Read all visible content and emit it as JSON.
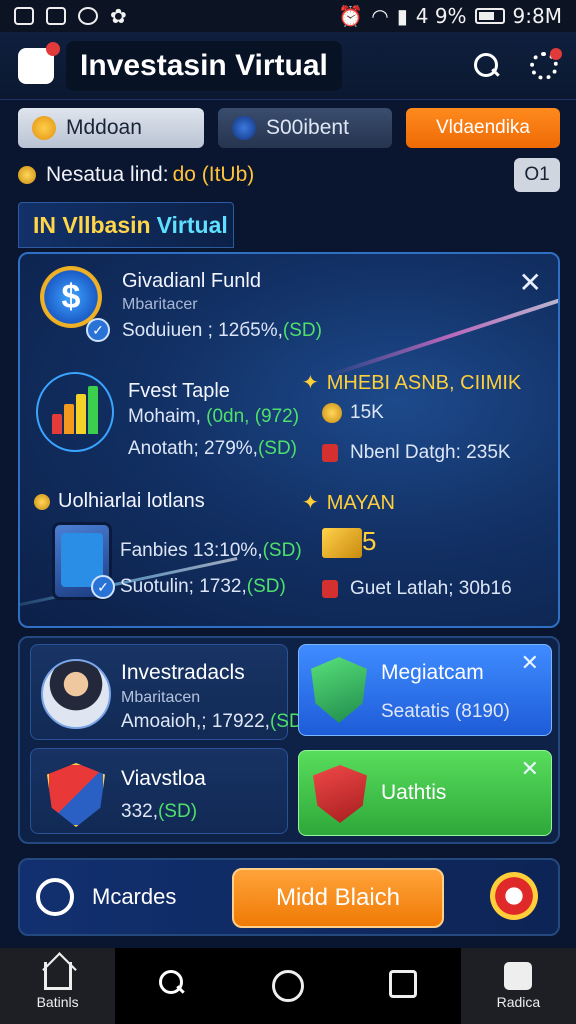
{
  "status_bar": {
    "battery": "4 9%",
    "time": "9:8M"
  },
  "app": {
    "title": "Investasin Virtual"
  },
  "chips": [
    {
      "label": "Mddoan",
      "color": "#c8cfdb"
    },
    {
      "label": "S00ibent",
      "color": "#2c3a58"
    },
    {
      "label": "Vldaendika",
      "color": "#f57a10"
    }
  ],
  "balance": {
    "prefix": "Nesatua lind:",
    "highlight": "do (ItUb)",
    "button": "O1"
  },
  "section": {
    "title_main": "IN Vllbasin",
    "title_accent": "Virtual"
  },
  "panel": {
    "close": "✕",
    "items": [
      {
        "title": "Givadianl Funld",
        "sub": "Mbaritacer",
        "line_prefix": "Soduiuen ; 12б5%,",
        "line_value": "(SD)"
      },
      {
        "title": "Fvest Taple",
        "line1_prefix": "Mohaim,",
        "line1_value": "(0dn, (972)",
        "line2_prefix": "Anotath; 279%,",
        "line2_value": "(SD)"
      },
      {
        "title": "Uolhiarlai lotlans",
        "line1_prefix": "Fanbies 13:10%,",
        "line1_value": "(SD)",
        "line2_prefix": "Suotulin; 1732,",
        "line2_value": "(SD)"
      }
    ],
    "right": {
      "heading1": "MHEBI ASNB, CIIMIK",
      "amount1": "15K",
      "detail1": "Nbenl Datgh: 235K",
      "heading2": "MAYAN",
      "amount2": "5",
      "detail2": "Guet Latlah; 30b16"
    }
  },
  "cards": {
    "investr": {
      "title": "Investradacls",
      "sub": "Mbaritacen",
      "line_prefix": "Amoaioh,; 17922,",
      "line_value": "(SD)"
    },
    "vias": {
      "title": "Viavstloa",
      "line_prefix": "332,",
      "line_value": "(SD)"
    },
    "mega": {
      "title": "Megiatcam",
      "line": "Seatatis (8190)",
      "close": "✕"
    },
    "uath": {
      "title": "Uathtis",
      "close": "✕"
    }
  },
  "action_bar": {
    "label": "Mcardes",
    "cta": "Midd Blaich"
  },
  "bottom_nav": [
    {
      "label": "Batinls",
      "icon": "home-icon"
    },
    {
      "label": "",
      "icon": "search-icon"
    },
    {
      "label": "",
      "icon": "circle-icon"
    },
    {
      "label": "",
      "icon": "calendar-check-icon"
    },
    {
      "label": "Radica",
      "icon": "bag-icon"
    }
  ]
}
